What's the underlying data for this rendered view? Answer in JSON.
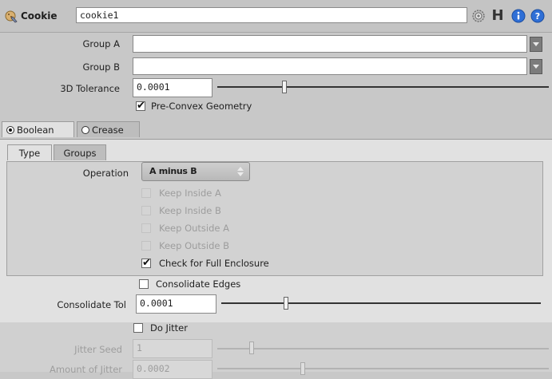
{
  "header": {
    "node_type": "Cookie",
    "node_name": "cookie1",
    "icons": [
      "cookie-node-icon",
      "gear-icon",
      "hotkey-icon",
      "help-icon",
      "info-icon"
    ],
    "hotkey_glyph": "H"
  },
  "params": {
    "group_a": {
      "label": "Group A",
      "value": ""
    },
    "group_b": {
      "label": "Group B",
      "value": ""
    },
    "tolerance_3d": {
      "label": "3D Tolerance",
      "value": "0.0001"
    },
    "pre_convex": {
      "label": "Pre-Convex Geometry",
      "checked": true
    }
  },
  "tabs": {
    "boolean": {
      "label": "Boolean",
      "selected": true
    },
    "crease": {
      "label": "Crease",
      "selected": false
    }
  },
  "subtabs": {
    "type": {
      "label": "Type"
    },
    "groups": {
      "label": "Groups"
    }
  },
  "type_tab": {
    "operation_label": "Operation",
    "operation_value": "A minus B",
    "keep_inside_a": {
      "label": "Keep Inside A",
      "checked": false,
      "enabled": false
    },
    "keep_inside_b": {
      "label": "Keep Inside B",
      "checked": false,
      "enabled": false
    },
    "keep_outside_a": {
      "label": "Keep Outside A",
      "checked": false,
      "enabled": false
    },
    "keep_outside_b": {
      "label": "Keep Outside B",
      "checked": false,
      "enabled": false
    },
    "full_enclosure": {
      "label": "Check for Full Enclosure",
      "checked": true,
      "enabled": true
    }
  },
  "consolidate": {
    "edges": {
      "label": "Consolidate Edges",
      "checked": false
    },
    "tol_label": "Consolidate Tol",
    "tol_value": "0.0001"
  },
  "jitter": {
    "do_jitter": {
      "label": "Do Jitter",
      "checked": false
    },
    "seed_label": "Jitter Seed",
    "seed_value": "1",
    "amount_label": "Amount of Jitter",
    "amount_value": "0.0002"
  },
  "colors": {
    "panel_bg": "#e1e1e1",
    "header_bg": "#c4c4c4",
    "help_blue": "#2f6fd6"
  }
}
